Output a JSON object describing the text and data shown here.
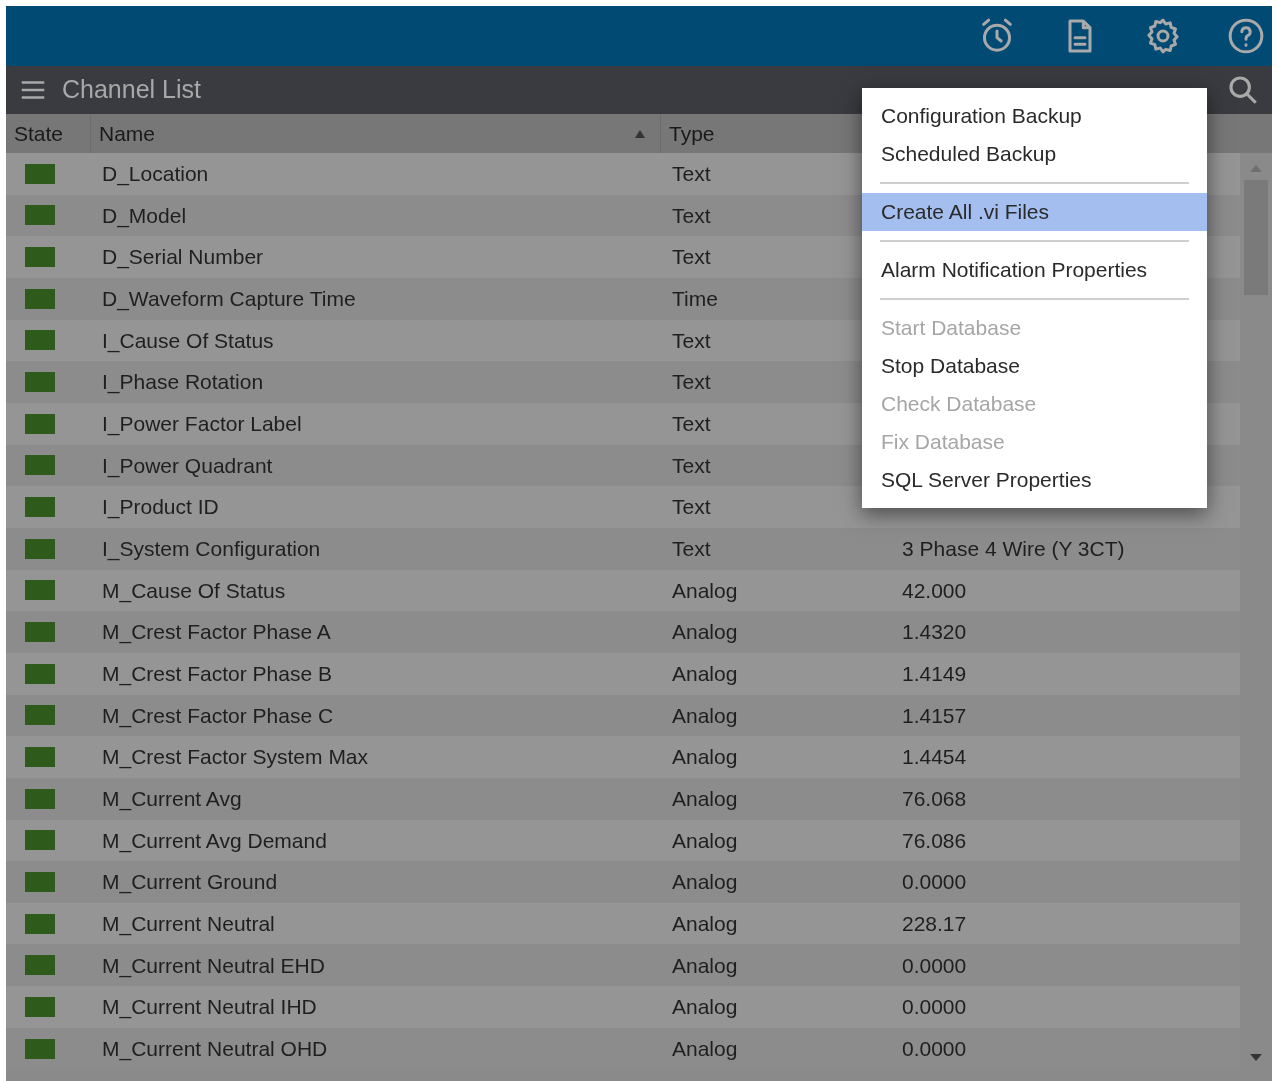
{
  "toolbar": {
    "title": "Channel List"
  },
  "table": {
    "columns": [
      {
        "label": "State"
      },
      {
        "label": "Name",
        "sorted": true
      },
      {
        "label": "Type"
      }
    ],
    "rows": [
      {
        "color": "#2e5a1c",
        "name": "D_Location",
        "type": "Text"
      },
      {
        "color": "#2e5a1c",
        "name": "D_Model",
        "type": "Text"
      },
      {
        "color": "#2e5a1c",
        "name": "D_Serial Number",
        "type": "Text"
      },
      {
        "color": "#2e5a1c",
        "name": "D_Waveform Capture Time",
        "type": "Time"
      },
      {
        "color": "#2e5a1c",
        "name": "I_Cause Of Status",
        "type": "Text"
      },
      {
        "color": "#2e5a1c",
        "name": "I_Phase Rotation",
        "type": "Text"
      },
      {
        "color": "#2e5a1c",
        "name": "I_Power Factor Label",
        "type": "Text"
      },
      {
        "color": "#2e5a1c",
        "name": "I_Power Quadrant",
        "type": "Text"
      },
      {
        "color": "#2e5a1c",
        "name": "I_Product ID",
        "type": "Text"
      },
      {
        "color": "#2e5a1c",
        "name": "I_System Configuration",
        "type": "Text",
        "value": "3 Phase 4 Wire (Y 3CT)"
      },
      {
        "color": "#2e5a1c",
        "name": "M_Cause Of Status",
        "type": "Analog",
        "value": "42.000"
      },
      {
        "color": "#2e5a1c",
        "name": "M_Crest Factor Phase A",
        "type": "Analog",
        "value": "1.4320"
      },
      {
        "color": "#2e5a1c",
        "name": "M_Crest Factor Phase B",
        "type": "Analog",
        "value": "1.4149"
      },
      {
        "color": "#2e5a1c",
        "name": "M_Crest Factor Phase C",
        "type": "Analog",
        "value": "1.4157"
      },
      {
        "color": "#2e5a1c",
        "name": "M_Crest Factor System Max",
        "type": "Analog",
        "value": "1.4454"
      },
      {
        "color": "#2e5a1c",
        "name": "M_Current Avg",
        "type": "Analog",
        "value": "76.068"
      },
      {
        "color": "#2e5a1c",
        "name": "M_Current Avg Demand",
        "type": "Analog",
        "value": "76.086"
      },
      {
        "color": "#2e5a1c",
        "name": "M_Current Ground",
        "type": "Analog",
        "value": "0.0000"
      },
      {
        "color": "#2e5a1c",
        "name": "M_Current Neutral",
        "type": "Analog",
        "value": "228.17"
      },
      {
        "color": "#2e5a1c",
        "name": "M_Current Neutral EHD",
        "type": "Analog",
        "value": "0.0000"
      },
      {
        "color": "#2e5a1c",
        "name": "M_Current Neutral IHD",
        "type": "Analog",
        "value": "0.0000"
      },
      {
        "color": "#2e5a1c",
        "name": "M_Current Neutral OHD",
        "type": "Analog",
        "value": "0.0000"
      }
    ]
  },
  "menu": {
    "items": [
      {
        "kind": "item",
        "label": "Configuration Backup",
        "disabled": false,
        "selected": false
      },
      {
        "kind": "item",
        "label": "Scheduled Backup",
        "disabled": false,
        "selected": false
      },
      {
        "kind": "separator"
      },
      {
        "kind": "item",
        "label": "Create All .vi Files",
        "disabled": false,
        "selected": true
      },
      {
        "kind": "separator"
      },
      {
        "kind": "item",
        "label": "Alarm Notification Properties",
        "disabled": false,
        "selected": false
      },
      {
        "kind": "separator"
      },
      {
        "kind": "item",
        "label": "Start Database",
        "disabled": true,
        "selected": false
      },
      {
        "kind": "item",
        "label": "Stop Database",
        "disabled": false,
        "selected": false
      },
      {
        "kind": "item",
        "label": "Check Database",
        "disabled": true,
        "selected": false
      },
      {
        "kind": "item",
        "label": "Fix Database",
        "disabled": true,
        "selected": false
      },
      {
        "kind": "item",
        "label": "SQL Server Properties",
        "disabled": false,
        "selected": false
      }
    ]
  }
}
